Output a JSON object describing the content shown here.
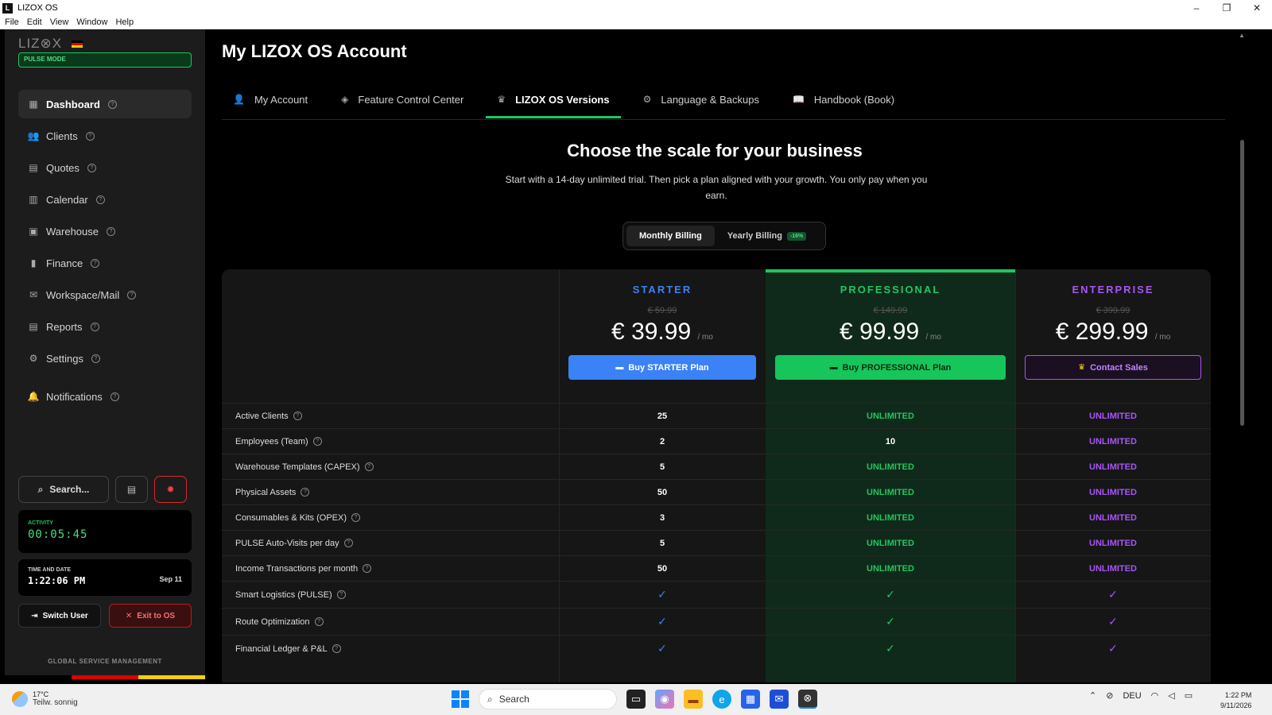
{
  "window": {
    "title": "LIZOX OS",
    "logo_letter": "L",
    "controls": [
      "–",
      "❐",
      "✕"
    ]
  },
  "menu": [
    "File",
    "Edit",
    "View",
    "Window",
    "Help"
  ],
  "sidebar": {
    "brand": "LIZ⊗X",
    "mode_badge": "PULSE MODE",
    "items": [
      {
        "label": "Dashboard",
        "icon": "grid-icon",
        "glyph": "▦",
        "active": true
      },
      {
        "label": "Clients",
        "icon": "users-icon",
        "glyph": "👥"
      },
      {
        "label": "Quotes",
        "icon": "document-icon",
        "glyph": "▤"
      },
      {
        "label": "Calendar",
        "icon": "calendar-icon",
        "glyph": "▥"
      },
      {
        "label": "Warehouse",
        "icon": "warehouse-icon",
        "glyph": "▣"
      },
      {
        "label": "Finance",
        "icon": "bar-chart-icon",
        "glyph": "▮"
      },
      {
        "label": "Workspace/Mail",
        "icon": "mail-icon",
        "glyph": "✉"
      },
      {
        "label": "Reports",
        "icon": "report-icon",
        "glyph": "▤"
      },
      {
        "label": "Settings",
        "icon": "gear-icon",
        "glyph": "⚙"
      },
      {
        "label": "Notifications",
        "icon": "bell-icon",
        "glyph": "🔔"
      }
    ],
    "search_label": "Search...",
    "activity": {
      "label": "ACTIVITY",
      "value": "00:05:45"
    },
    "time_date": {
      "label": "TIME AND DATE",
      "time": "1:22:06 PM",
      "date": "Sep 11"
    },
    "switch_user": "Switch User",
    "exit": "Exit to OS",
    "footer": "GLOBAL SERVICE MANAGEMENT"
  },
  "main": {
    "title": "My LIZOX OS Account",
    "tabs": [
      {
        "label": "My Account",
        "icon": "user-icon",
        "glyph": "👤"
      },
      {
        "label": "Feature Control Center",
        "icon": "layers-icon",
        "glyph": "◈"
      },
      {
        "label": "LIZOX OS Versions",
        "icon": "crown-icon",
        "glyph": "♛",
        "active": true
      },
      {
        "label": "Language & Backups",
        "icon": "gear-icon",
        "glyph": "⚙"
      },
      {
        "label": "Handbook (Book)",
        "icon": "book-icon",
        "glyph": "📖"
      }
    ],
    "hero_title": "Choose the scale for your business",
    "hero_sub": "Start with a 14-day unlimited trial. Then pick a plan aligned with your growth. You only pay when you earn.",
    "billing": {
      "monthly": "Monthly Billing",
      "yearly": "Yearly Billing",
      "discount": "-16%"
    }
  },
  "plans": [
    {
      "name": "STARTER",
      "old": "€ 59.99",
      "price": "€ 39.99",
      "per": "/ mo",
      "cta": "Buy STARTER Plan",
      "color": "#3b82f6"
    },
    {
      "name": "PROFESSIONAL",
      "old": "€ 149.99",
      "price": "€ 99.99",
      "per": "/ mo",
      "cta": "Buy PROFESSIONAL Plan",
      "color": "#22c55e"
    },
    {
      "name": "ENTERPRISE",
      "old": "€ 399.99",
      "price": "€ 299.99",
      "per": "/ mo",
      "cta": "Contact Sales",
      "color": "#a855f7"
    }
  ],
  "features": [
    {
      "name": "Active Clients",
      "values": [
        "25",
        "UNLIMITED",
        "UNLIMITED"
      ]
    },
    {
      "name": "Employees (Team)",
      "values": [
        "2",
        "10",
        "UNLIMITED"
      ]
    },
    {
      "name": "Warehouse Templates (CAPEX)",
      "values": [
        "5",
        "UNLIMITED",
        "UNLIMITED"
      ]
    },
    {
      "name": "Physical Assets",
      "values": [
        "50",
        "UNLIMITED",
        "UNLIMITED"
      ]
    },
    {
      "name": "Consumables & Kits (OPEX)",
      "values": [
        "3",
        "UNLIMITED",
        "UNLIMITED"
      ]
    },
    {
      "name": "PULSE Auto-Visits per day",
      "values": [
        "5",
        "UNLIMITED",
        "UNLIMITED"
      ]
    },
    {
      "name": "Income Transactions per month",
      "values": [
        "50",
        "UNLIMITED",
        "UNLIMITED"
      ]
    },
    {
      "name": "Smart Logistics (PULSE)",
      "values": [
        "✓",
        "✓",
        "✓"
      ]
    },
    {
      "name": "Route Optimization",
      "values": [
        "✓",
        "✓",
        "✓"
      ]
    },
    {
      "name": "Financial Ledger & P&L",
      "values": [
        "✓",
        "✓",
        "✓"
      ]
    }
  ],
  "taskbar": {
    "weather_temp": "17°C",
    "weather_desc": "Teilw. sonnig",
    "search": "Search",
    "lang": "DEU",
    "time": "1:22 PM",
    "date": "9/11/2026"
  }
}
